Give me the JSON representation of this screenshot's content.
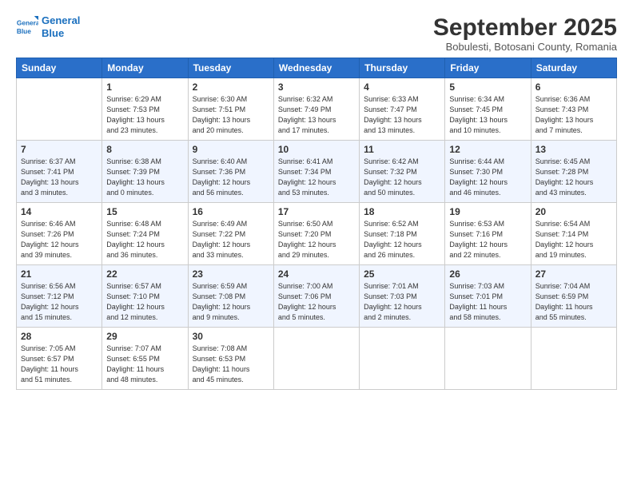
{
  "logo": {
    "line1": "General",
    "line2": "Blue"
  },
  "title": "September 2025",
  "subtitle": "Bobulesti, Botosani County, Romania",
  "headers": [
    "Sunday",
    "Monday",
    "Tuesday",
    "Wednesday",
    "Thursday",
    "Friday",
    "Saturday"
  ],
  "weeks": [
    [
      {
        "num": "",
        "info": ""
      },
      {
        "num": "1",
        "info": "Sunrise: 6:29 AM\nSunset: 7:53 PM\nDaylight: 13 hours\nand 23 minutes."
      },
      {
        "num": "2",
        "info": "Sunrise: 6:30 AM\nSunset: 7:51 PM\nDaylight: 13 hours\nand 20 minutes."
      },
      {
        "num": "3",
        "info": "Sunrise: 6:32 AM\nSunset: 7:49 PM\nDaylight: 13 hours\nand 17 minutes."
      },
      {
        "num": "4",
        "info": "Sunrise: 6:33 AM\nSunset: 7:47 PM\nDaylight: 13 hours\nand 13 minutes."
      },
      {
        "num": "5",
        "info": "Sunrise: 6:34 AM\nSunset: 7:45 PM\nDaylight: 13 hours\nand 10 minutes."
      },
      {
        "num": "6",
        "info": "Sunrise: 6:36 AM\nSunset: 7:43 PM\nDaylight: 13 hours\nand 7 minutes."
      }
    ],
    [
      {
        "num": "7",
        "info": "Sunrise: 6:37 AM\nSunset: 7:41 PM\nDaylight: 13 hours\nand 3 minutes."
      },
      {
        "num": "8",
        "info": "Sunrise: 6:38 AM\nSunset: 7:39 PM\nDaylight: 13 hours\nand 0 minutes."
      },
      {
        "num": "9",
        "info": "Sunrise: 6:40 AM\nSunset: 7:36 PM\nDaylight: 12 hours\nand 56 minutes."
      },
      {
        "num": "10",
        "info": "Sunrise: 6:41 AM\nSunset: 7:34 PM\nDaylight: 12 hours\nand 53 minutes."
      },
      {
        "num": "11",
        "info": "Sunrise: 6:42 AM\nSunset: 7:32 PM\nDaylight: 12 hours\nand 50 minutes."
      },
      {
        "num": "12",
        "info": "Sunrise: 6:44 AM\nSunset: 7:30 PM\nDaylight: 12 hours\nand 46 minutes."
      },
      {
        "num": "13",
        "info": "Sunrise: 6:45 AM\nSunset: 7:28 PM\nDaylight: 12 hours\nand 43 minutes."
      }
    ],
    [
      {
        "num": "14",
        "info": "Sunrise: 6:46 AM\nSunset: 7:26 PM\nDaylight: 12 hours\nand 39 minutes."
      },
      {
        "num": "15",
        "info": "Sunrise: 6:48 AM\nSunset: 7:24 PM\nDaylight: 12 hours\nand 36 minutes."
      },
      {
        "num": "16",
        "info": "Sunrise: 6:49 AM\nSunset: 7:22 PM\nDaylight: 12 hours\nand 33 minutes."
      },
      {
        "num": "17",
        "info": "Sunrise: 6:50 AM\nSunset: 7:20 PM\nDaylight: 12 hours\nand 29 minutes."
      },
      {
        "num": "18",
        "info": "Sunrise: 6:52 AM\nSunset: 7:18 PM\nDaylight: 12 hours\nand 26 minutes."
      },
      {
        "num": "19",
        "info": "Sunrise: 6:53 AM\nSunset: 7:16 PM\nDaylight: 12 hours\nand 22 minutes."
      },
      {
        "num": "20",
        "info": "Sunrise: 6:54 AM\nSunset: 7:14 PM\nDaylight: 12 hours\nand 19 minutes."
      }
    ],
    [
      {
        "num": "21",
        "info": "Sunrise: 6:56 AM\nSunset: 7:12 PM\nDaylight: 12 hours\nand 15 minutes."
      },
      {
        "num": "22",
        "info": "Sunrise: 6:57 AM\nSunset: 7:10 PM\nDaylight: 12 hours\nand 12 minutes."
      },
      {
        "num": "23",
        "info": "Sunrise: 6:59 AM\nSunset: 7:08 PM\nDaylight: 12 hours\nand 9 minutes."
      },
      {
        "num": "24",
        "info": "Sunrise: 7:00 AM\nSunset: 7:06 PM\nDaylight: 12 hours\nand 5 minutes."
      },
      {
        "num": "25",
        "info": "Sunrise: 7:01 AM\nSunset: 7:03 PM\nDaylight: 12 hours\nand 2 minutes."
      },
      {
        "num": "26",
        "info": "Sunrise: 7:03 AM\nSunset: 7:01 PM\nDaylight: 11 hours\nand 58 minutes."
      },
      {
        "num": "27",
        "info": "Sunrise: 7:04 AM\nSunset: 6:59 PM\nDaylight: 11 hours\nand 55 minutes."
      }
    ],
    [
      {
        "num": "28",
        "info": "Sunrise: 7:05 AM\nSunset: 6:57 PM\nDaylight: 11 hours\nand 51 minutes."
      },
      {
        "num": "29",
        "info": "Sunrise: 7:07 AM\nSunset: 6:55 PM\nDaylight: 11 hours\nand 48 minutes."
      },
      {
        "num": "30",
        "info": "Sunrise: 7:08 AM\nSunset: 6:53 PM\nDaylight: 11 hours\nand 45 minutes."
      },
      {
        "num": "",
        "info": ""
      },
      {
        "num": "",
        "info": ""
      },
      {
        "num": "",
        "info": ""
      },
      {
        "num": "",
        "info": ""
      }
    ]
  ]
}
